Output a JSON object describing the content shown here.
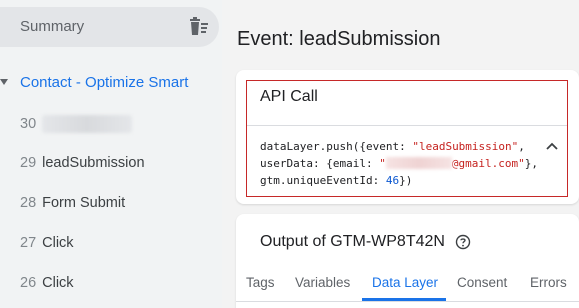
{
  "sidebar": {
    "summary_label": "Summary",
    "container_name": "Contact - Optimize Smart",
    "events": [
      {
        "num": "30",
        "label": "",
        "redacted": true
      },
      {
        "num": "29",
        "label": "leadSubmission"
      },
      {
        "num": "28",
        "label": "Form Submit"
      },
      {
        "num": "27",
        "label": "Click"
      },
      {
        "num": "26",
        "label": "Click"
      }
    ]
  },
  "main": {
    "event_title": "Event: leadSubmission",
    "api_call": {
      "title": "API Call",
      "code_line1_prefix": "dataLayer.push({event: ",
      "code_line1_event": "\"leadSubmission\"",
      "code_line1_suffix": ",",
      "code_line2_prefix": "userData: {email: ",
      "code_line2_quote_open": "\"",
      "code_line2_email_suffix": "@gmail.com\"",
      "code_line2_suffix": "},",
      "code_line3_prefix": "gtm.uniqueEventId: ",
      "code_line3_value": "46",
      "code_line3_suffix": "})"
    },
    "output": {
      "title": "Output of GTM-WP8T42N",
      "tabs": [
        "Tags",
        "Variables",
        "Data Layer",
        "Consent",
        "Errors"
      ],
      "active_tab": "Data Layer"
    }
  },
  "colors": {
    "accent": "#1a73e8",
    "highlight_border": "#c62828",
    "string": "#c5221f"
  }
}
